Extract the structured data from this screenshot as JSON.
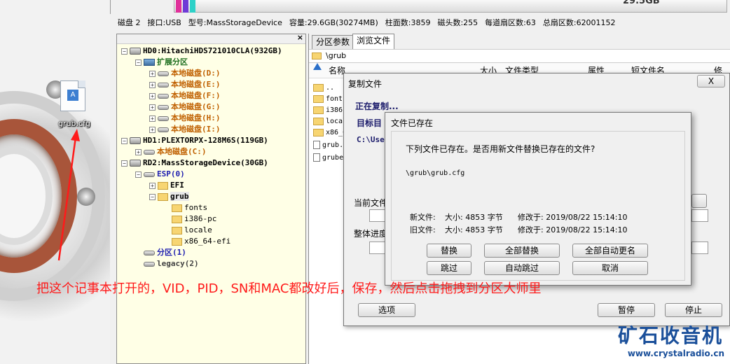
{
  "desktop": {
    "file_label": "grub.cfg"
  },
  "top_strip": {
    "partition_label": "29.5GB"
  },
  "disk_info": {
    "disk": "磁盘 2",
    "interface": "接口:USB",
    "model": "型号:MassStorageDevice",
    "capacity": "容量:29.6GB(30274MB)",
    "cylinders": "柱面数:3859",
    "heads": "磁头数:255",
    "sectors_per_track": "每道扇区数:63",
    "total_sectors": "总扇区数:62001152"
  },
  "tree": {
    "close": "×",
    "hd0": "HD0:HitachiHDS721010CLA(932GB)",
    "extended": "扩展分区",
    "d": "本地磁盘(D:)",
    "e": "本地磁盘(E:)",
    "f": "本地磁盘(F:)",
    "g": "本地磁盘(G:)",
    "h": "本地磁盘(H:)",
    "i": "本地磁盘(I:)",
    "hd1": "HD1:PLEXTORPX-128M6S(119GB)",
    "c": "本地磁盘(C:)",
    "rd2": "RD2:MassStorageDevice(30GB)",
    "esp": "ESP(0)",
    "efi": "EFI",
    "grub": "grub",
    "fonts": "fonts",
    "i386": "i386-pc",
    "locale": "locale",
    "x86": "x86_64-efi",
    "part1": "分区(1)",
    "legacy": "legacy(2)"
  },
  "right": {
    "tabs": [
      "分区参数",
      "浏览文件"
    ],
    "path": "\\grub",
    "col_name": "名称",
    "col_size": "大小",
    "col_type": "文件类型",
    "col_attr": "属性",
    "col_short": "短文件名",
    "col_mod": "修改",
    "rows": [
      "..",
      "fonts",
      "i386-",
      "local",
      "x86_6",
      "grub.",
      "grube"
    ]
  },
  "copy_dialog": {
    "title": "复制文件",
    "close": "X",
    "copying": "正在复制...",
    "target": "目标目",
    "target_path": "C:\\Use",
    "current_file": "当前文件",
    "overall": "整体进度",
    "options": "选项",
    "pause": "暂停",
    "stop": "停止"
  },
  "exists_dialog": {
    "title": "文件已存在",
    "question": "下列文件已存在。是否用新文件替换已存在的文件?",
    "path": "\\grub\\grub.cfg",
    "new_label": "新文件:",
    "new_size": "大小: 4853 字节",
    "new_mod": "修改于: 2019/08/22 15:14:10",
    "old_label": "旧文件:",
    "old_size": "大小: 4853 字节",
    "old_mod": "修改于: 2019/08/22 15:14:10",
    "buttons": {
      "replace": "替换",
      "replace_all": "全部替换",
      "rename_all": "全部自动更名",
      "skip": "跳过",
      "skip_auto": "自动跳过",
      "cancel": "取消"
    }
  },
  "annotation": "把这个记事本打开的，VID，PID，SN和MAC都改好后，保存，然后点击拖拽到分区大师里",
  "watermark": {
    "cn": "矿石收音机",
    "url": "www.crystalradio.cn"
  },
  "colors": {
    "annotation": "#ff1a1a",
    "watermark": "#1a4f9a",
    "tree_bg": "#ffffe6"
  }
}
